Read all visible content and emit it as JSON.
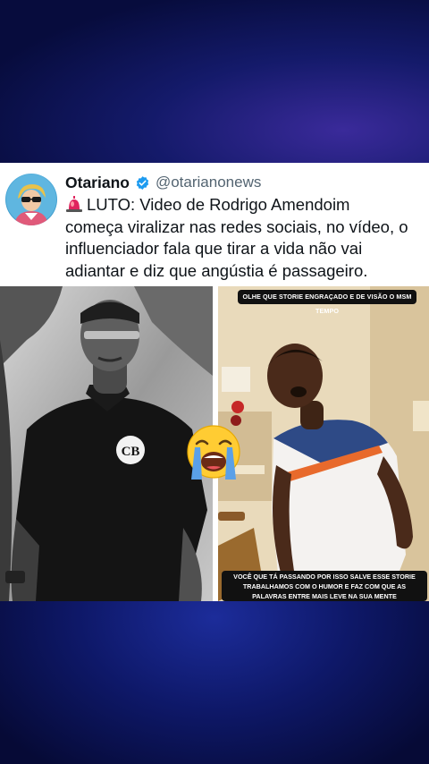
{
  "post": {
    "display_name": "Otariano",
    "handle": "@otarianonews",
    "verified_icon": "verified-badge-icon",
    "siren_icon": "police-light-emoji",
    "text_prefix": "LUTO: ",
    "text_line_1": "Video de Rodrigo Amendoim",
    "text_line_2": "começa viralizar nas redes sociais, no vídeo, o",
    "text_line_3": "influenciador fala que tirar a vida não vai",
    "text_line_4": "adiantar e diz que angústia é passageiro."
  },
  "media": {
    "left_logo": "CB",
    "right_caption_top": "OLHE QUE STORIE ENGRAÇADO E DE VISÃO O MSM TEMPO",
    "right_caption_bottom_1": "VOCÊ QUE TÁ PASSANDO POR ISSO SALVE ESSE STORIE",
    "right_caption_bottom_2": "TRABALHAMOS COM O HUMOR E FAZ COM QUE AS",
    "right_caption_bottom_3": "PALAVRAS ENTRE MAIS LEVE NA SUA MENTE",
    "emoji": "loudly-crying-face"
  },
  "colors": {
    "accent_blue": "#1d9bf0",
    "background_navy": "#0a1250",
    "text_primary": "#0f1419",
    "text_secondary": "#536471"
  }
}
